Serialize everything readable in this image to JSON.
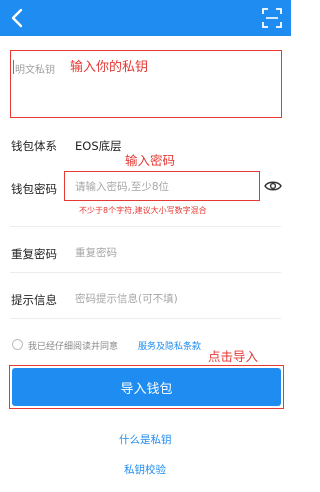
{
  "header": {
    "back_icon": "chevron-left-icon",
    "scan_icon": "scan-icon",
    "color": "#1e8cf0"
  },
  "private_key": {
    "placeholder": "明文私钥",
    "annotation": "输入你的私钥"
  },
  "wallet_system": {
    "label": "钱包体系",
    "value": "EOS底层"
  },
  "wallet_password": {
    "annotation": "输入密码",
    "label": "钱包密码",
    "placeholder": "请输入密码,至少8位",
    "hint": "不少于8个字符,建议大小写数字混合",
    "eye_icon": "eye-icon"
  },
  "repeat_password": {
    "label": "重复密码",
    "placeholder": "重复密码"
  },
  "prompt_info": {
    "label": "提示信息",
    "placeholder": "密码提示信息(可不填)"
  },
  "agreement": {
    "text": "我已经仔细阅读并同意",
    "link": "服务及隐私条款"
  },
  "import": {
    "annotation": "点击导入",
    "button_label": "导入钱包"
  },
  "links": {
    "what_is_key": "什么是私钥",
    "verify_key": "私钥校验"
  },
  "colors": {
    "accent": "#1e8cf0",
    "annotation": "#e53935"
  }
}
